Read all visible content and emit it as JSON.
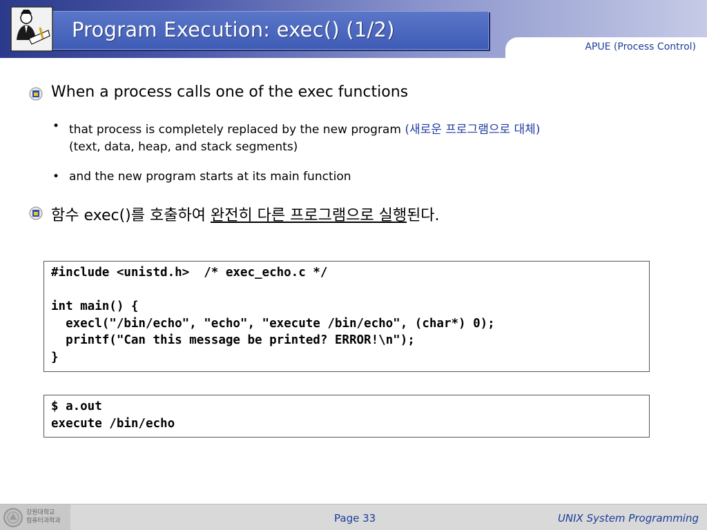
{
  "header": {
    "title": "Program Execution: exec() (1/2)",
    "subtitle": "APUE (Process Control)",
    "logo_icon": "person-with-book-icon"
  },
  "bullets": [
    {
      "text": "When a process calls one of the exec functions"
    },
    {
      "text": "that process is completely replaced by the new program ",
      "text_kr": "(새로운 프로그램으로 대체)",
      "text2": "(text, data, heap, and stack segments)"
    },
    {
      "text": "and the new program starts at its main function"
    },
    {
      "text_a": "함수 exec()를 호출하여 ",
      "text_underline": "완전히 다른 프로그램으로 실행",
      "text_b": "된다."
    }
  ],
  "code": {
    "source": "#include <unistd.h>  /* exec_echo.c */\n\nint main() {\n  execl(\"/bin/echo\", \"echo\", \"execute /bin/echo\", (char*) 0);\n  printf(\"Can this message be printed? ERROR!\\n\");\n}",
    "output": "$ a.out\nexecute /bin/echo"
  },
  "footer": {
    "school": [
      "강원대학교",
      "컴퓨터과학과"
    ],
    "page": "Page 33",
    "course": "UNIX System Programming"
  },
  "colors": {
    "accent": "#1a3d9a",
    "title_bg": "#3f5cb6"
  }
}
